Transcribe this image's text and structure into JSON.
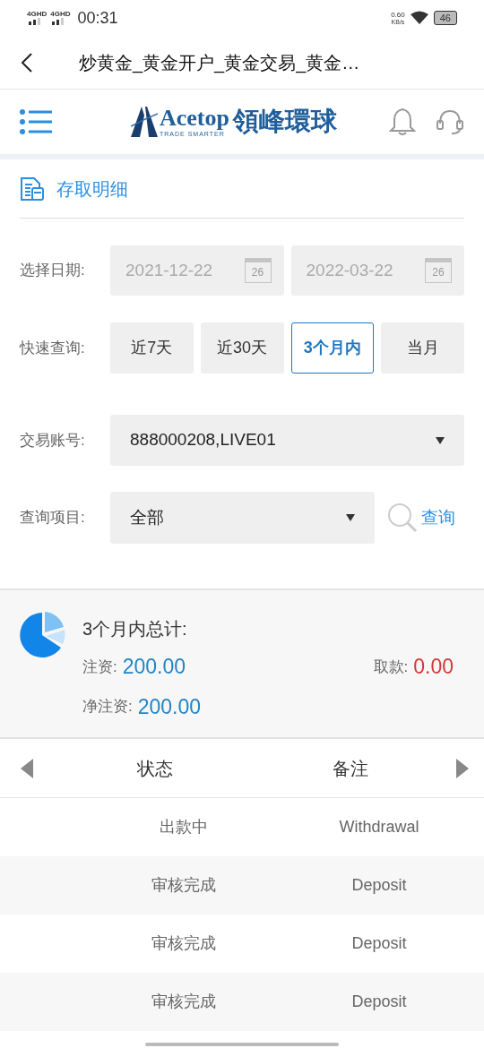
{
  "status_bar": {
    "signal_labels": [
      "4GHD",
      "4GHD"
    ],
    "time": "00:31",
    "speed": "0.60",
    "speed_unit": "KB/s",
    "battery": "46"
  },
  "title_bar": {
    "title": "炒黄金_黄金开户_黄金交易_黄金…"
  },
  "header": {
    "brand": "Acetop",
    "tagline": "TRADE SMARTER",
    "brand_cn": "領峰環球"
  },
  "section": {
    "title": "存取明细"
  },
  "date_row": {
    "label": "选择日期:",
    "from": "2021-12-22",
    "to": "2022-03-22",
    "from_calendar_day": "26",
    "to_calendar_day": "26"
  },
  "quick_row": {
    "label": "快速查询:",
    "options": [
      {
        "label": "近7天",
        "selected": false
      },
      {
        "label": "近30天",
        "selected": false
      },
      {
        "label": "3个月内",
        "selected": true
      },
      {
        "label": "当月",
        "selected": false
      }
    ]
  },
  "account_row": {
    "label": "交易账号:",
    "value": "888000208,LIVE01"
  },
  "item_row": {
    "label": "查询项目:",
    "value": "全部",
    "search_button": "查询"
  },
  "summary": {
    "title": "3个月内总计:",
    "deposit_label": "注资:",
    "deposit": "200.00",
    "withdraw_label": "取款:",
    "withdraw": "0.00",
    "net_label": "净注资:",
    "net": "200.00"
  },
  "table": {
    "columns": [
      "状态",
      "备注"
    ],
    "rows": [
      {
        "status": "出款中",
        "note": "Withdrawal"
      },
      {
        "status": "审核完成",
        "note": "Deposit"
      },
      {
        "status": "审核完成",
        "note": "Deposit"
      },
      {
        "status": "审核完成",
        "note": "Deposit"
      }
    ]
  }
}
